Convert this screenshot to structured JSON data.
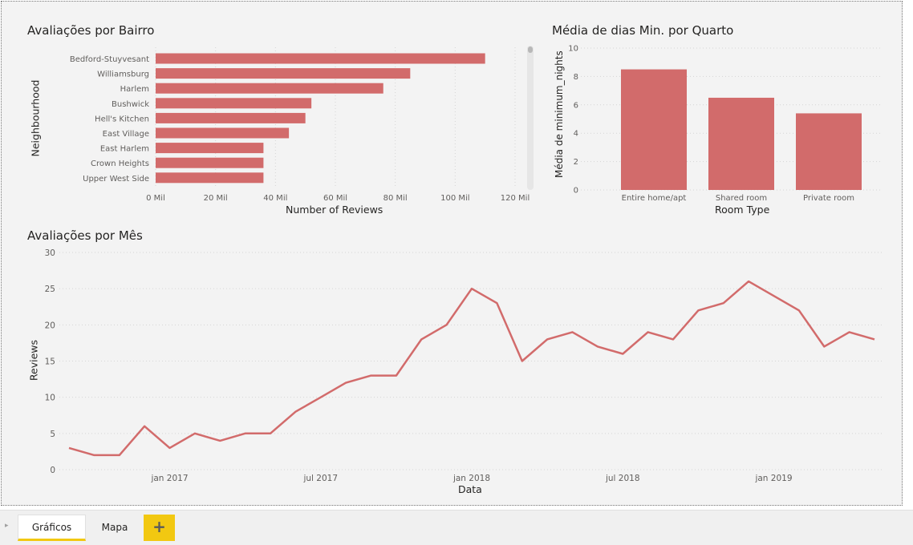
{
  "colors": {
    "bar": "#d26b6b",
    "line": "#d26b6b",
    "tab_accent": "#f2c811",
    "canvas": "#f3f3f3"
  },
  "tabs": {
    "items": [
      "Gráficos",
      "Mapa"
    ],
    "add_label": "+",
    "arrow": "▸"
  },
  "chart_data": [
    {
      "type": "bar",
      "orientation": "horizontal",
      "title": "Avaliações por Bairro",
      "xlabel": "Number of Reviews",
      "ylabel": "Neighbourhood",
      "categories": [
        "Bedford-Stuyvesant",
        "Williamsburg",
        "Harlem",
        "Bushwick",
        "Hell's Kitchen",
        "East Village",
        "East Harlem",
        "Crown Heights",
        "Upper West Side"
      ],
      "values": [
        110000,
        85000,
        76000,
        52000,
        50000,
        44500,
        36000,
        36000,
        36000
      ],
      "ticks": [
        0,
        20000,
        40000,
        60000,
        80000,
        100000,
        120000
      ],
      "tick_labels": [
        "0 Mil",
        "20 Mil",
        "40 Mil",
        "60 Mil",
        "80 Mil",
        "100 Mil",
        "120 Mil"
      ],
      "xlim": [
        0,
        120000
      ],
      "grid": true
    },
    {
      "type": "bar",
      "title": "Média de dias Min. por Quarto",
      "xlabel": "Room Type",
      "ylabel": "Média de minimum_nights",
      "categories": [
        "Entire home/apt",
        "Shared room",
        "Private room"
      ],
      "values": [
        8.5,
        6.5,
        5.4
      ],
      "ticks": [
        0,
        2,
        4,
        6,
        8,
        10
      ],
      "ylim": [
        0,
        10
      ],
      "grid": true
    },
    {
      "type": "line",
      "title": "Avaliações por Mês",
      "xlabel": "Data",
      "ylabel": "Reviews",
      "x": [
        "2016-09",
        "2016-10",
        "2016-11",
        "2016-12",
        "2017-01",
        "2017-02",
        "2017-03",
        "2017-04",
        "2017-05",
        "2017-06",
        "2017-07",
        "2017-08",
        "2017-09",
        "2017-10",
        "2017-11",
        "2017-12",
        "2018-01",
        "2018-02",
        "2018-03",
        "2018-04",
        "2018-05",
        "2018-06",
        "2018-07",
        "2018-08",
        "2018-09",
        "2018-10",
        "2018-11",
        "2018-12",
        "2019-01",
        "2019-02",
        "2019-03",
        "2019-04",
        "2019-05"
      ],
      "values": [
        3,
        2,
        2,
        6,
        3,
        5,
        4,
        5,
        5,
        8,
        10,
        12,
        13,
        13,
        18,
        20,
        25,
        23,
        15,
        18,
        19,
        17,
        16,
        19,
        18,
        22,
        23,
        26,
        24,
        22,
        17,
        19,
        18
      ],
      "x_tick_labels": [
        {
          "date": "2017-01",
          "label": "jan 2017"
        },
        {
          "date": "2017-07",
          "label": "jul 2017"
        },
        {
          "date": "2018-01",
          "label": "jan 2018"
        },
        {
          "date": "2018-07",
          "label": "jul 2018"
        },
        {
          "date": "2019-01",
          "label": "jan 2019"
        }
      ],
      "y_ticks": [
        0,
        5,
        10,
        15,
        20,
        25,
        30
      ],
      "ylim": [
        0,
        30
      ],
      "grid": true
    }
  ]
}
